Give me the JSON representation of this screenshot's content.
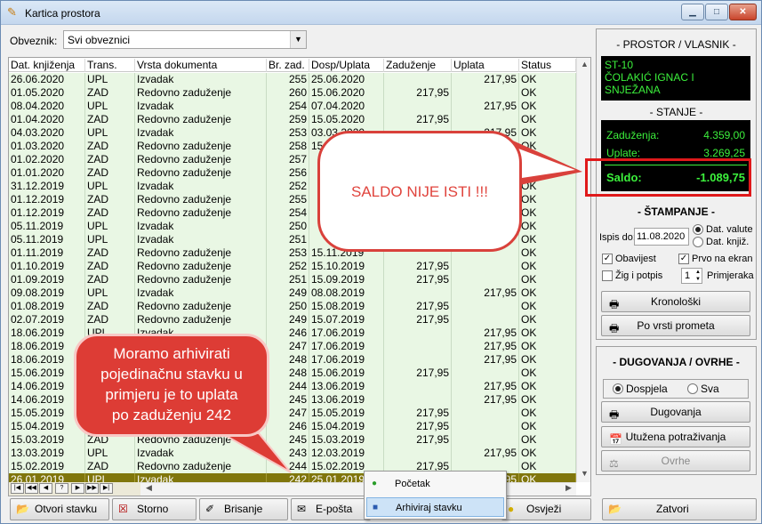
{
  "window": {
    "title": "Kartica prostora",
    "min": "▁",
    "max": "□",
    "close": "✕"
  },
  "filter": {
    "label": "Obveznik:",
    "value": "Svi obveznici"
  },
  "grid": {
    "headers": [
      "Dat. knjiženja",
      "Trans.",
      "Vrsta dokumenta",
      "Br. zad.",
      "Dosp/Uplata",
      "Zaduženje",
      "Uplata",
      "Status"
    ],
    "rows": [
      [
        "26.06.2020",
        "UPL",
        "Izvadak",
        "255",
        "25.06.2020",
        "",
        "217,95",
        "OK"
      ],
      [
        "01.05.2020",
        "ZAD",
        "Redovno zaduženje",
        "260",
        "15.06.2020",
        "217,95",
        "",
        "OK"
      ],
      [
        "08.04.2020",
        "UPL",
        "Izvadak",
        "254",
        "07.04.2020",
        "",
        "217,95",
        "OK"
      ],
      [
        "01.04.2020",
        "ZAD",
        "Redovno zaduženje",
        "259",
        "15.05.2020",
        "217,95",
        "",
        "OK"
      ],
      [
        "04.03.2020",
        "UPL",
        "Izvadak",
        "253",
        "03.03.2020",
        "",
        "217,95",
        "OK"
      ],
      [
        "01.03.2020",
        "ZAD",
        "Redovno zaduženje",
        "258",
        "15.04.2020",
        "",
        "",
        "OK"
      ],
      [
        "01.02.2020",
        "ZAD",
        "Redovno zaduženje",
        "257",
        "",
        "",
        "",
        "OK"
      ],
      [
        "01.01.2020",
        "ZAD",
        "Redovno zaduženje",
        "256",
        "",
        "",
        "",
        "OK"
      ],
      [
        "31.12.2019",
        "UPL",
        "Izvadak",
        "252",
        "",
        "",
        "",
        "OK"
      ],
      [
        "01.12.2019",
        "ZAD",
        "Redovno zaduženje",
        "255",
        "",
        "",
        "",
        "OK"
      ],
      [
        "01.12.2019",
        "ZAD",
        "Redovno zaduženje",
        "254",
        "",
        "",
        "",
        "OK"
      ],
      [
        "05.11.2019",
        "UPL",
        "Izvadak",
        "250",
        "",
        "",
        "",
        "OK"
      ],
      [
        "05.11.2019",
        "UPL",
        "Izvadak",
        "251",
        "",
        "",
        "",
        "OK"
      ],
      [
        "01.11.2019",
        "ZAD",
        "Redovno zaduženje",
        "253",
        "15.11.2019",
        "",
        "",
        "OK"
      ],
      [
        "01.10.2019",
        "ZAD",
        "Redovno zaduženje",
        "252",
        "15.10.2019",
        "217,95",
        "",
        "OK"
      ],
      [
        "01.09.2019",
        "ZAD",
        "Redovno zaduženje",
        "251",
        "15.09.2019",
        "217,95",
        "",
        "OK"
      ],
      [
        "09.08.2019",
        "UPL",
        "Izvadak",
        "249",
        "08.08.2019",
        "",
        "217,95",
        "OK"
      ],
      [
        "01.08.2019",
        "ZAD",
        "Redovno zaduženje",
        "250",
        "15.08.2019",
        "217,95",
        "",
        "OK"
      ],
      [
        "02.07.2019",
        "ZAD",
        "Redovno zaduženje",
        "249",
        "15.07.2019",
        "217,95",
        "",
        "OK"
      ],
      [
        "18.06.2019",
        "UPL",
        "Izvadak",
        "246",
        "17.06.2019",
        "",
        "217,95",
        "OK"
      ],
      [
        "18.06.2019",
        "UPL",
        "Izvadak",
        "247",
        "17.06.2019",
        "",
        "217,95",
        "OK"
      ],
      [
        "18.06.2019",
        "UPL",
        "Izvadak",
        "248",
        "17.06.2019",
        "",
        "217,95",
        "OK"
      ],
      [
        "15.06.2019",
        "ZAD",
        "Redovno zaduženje",
        "248",
        "15.06.2019",
        "217,95",
        "",
        "OK"
      ],
      [
        "14.06.2019",
        "UPL",
        "Izvadak",
        "244",
        "13.06.2019",
        "",
        "217,95",
        "OK"
      ],
      [
        "14.06.2019",
        "UPL",
        "Izvadak",
        "245",
        "13.06.2019",
        "",
        "217,95",
        "OK"
      ],
      [
        "15.05.2019",
        "ZAD",
        "Redovno zaduženje",
        "247",
        "15.05.2019",
        "217,95",
        "",
        "OK"
      ],
      [
        "15.04.2019",
        "ZAD",
        "Redovno zaduženje",
        "246",
        "15.04.2019",
        "217,95",
        "",
        "OK"
      ],
      [
        "15.03.2019",
        "ZAD",
        "Redovno zaduženje",
        "245",
        "15.03.2019",
        "217,95",
        "",
        "OK"
      ],
      [
        "13.03.2019",
        "UPL",
        "Izvadak",
        "243",
        "12.03.2019",
        "",
        "217,95",
        "OK"
      ],
      [
        "15.02.2019",
        "ZAD",
        "Redovno zaduženje",
        "244",
        "15.02.2019",
        "217,95",
        "",
        "OK"
      ],
      [
        "26.01.2019",
        "UPL",
        "Izvadak",
        "242",
        "25.01.2019",
        "",
        "217,95",
        "OK"
      ]
    ],
    "selected_row": 30,
    "nav": [
      "|◀",
      "◀◀",
      "◀",
      "?",
      "▶",
      "▶▶",
      "▶|"
    ]
  },
  "right": {
    "prostor_head": "- PROSTOR / VLASNIK -",
    "prostor_lines": [
      "ST-10",
      "ČOLAKIĆ IGNAC I",
      "SNJEŽANA"
    ],
    "stanje_head": "- STANJE -",
    "zaduzenja_label": "Zaduženja:",
    "zaduzenja_value": "4.359,00",
    "uplate_label": "Uplate:",
    "uplate_value": "3.269,25",
    "saldo_label": "Saldo:",
    "saldo_value": "-1.089,75",
    "stampanje_head": "- ŠTAMPANJE -",
    "ispis_label": "Ispis do:",
    "ispis_value": "11.08.2020",
    "opt_valute": "Dat. valute",
    "opt_knjiz": "Dat. knjiž.",
    "obavijest": "Obavijest",
    "prvo_na_ekran": "Prvo na ekran",
    "zig": "Žig i potpis",
    "primjeraka_value": "1",
    "primjeraka": "Primjeraka",
    "kronoloski": "Kronološki",
    "po_vrsti": "Po vrsti prometa",
    "dug_head": "- DUGOVANJA / OVRHE -",
    "dospjela": "Dospjela",
    "sva": "Sva",
    "dugovanja": "Dugovanja",
    "utuzena": "Utužena potraživanja",
    "ovrhe": "Ovrhe"
  },
  "bottom": {
    "otvori": "Otvori stavku",
    "storno": "Storno",
    "brisanje": "Brisanje",
    "eposta": "E-pošta",
    "osvjezi": "Osvježi",
    "zatvori": "Zatvori"
  },
  "context_menu": {
    "items": [
      "Početak",
      "Arhiviraj stavku"
    ]
  },
  "annotations": {
    "saldo_note": "SALDO NIJE ISTI !!!",
    "arhiv_note": [
      "Moramo arhivirati",
      "pojedinačnu stavku u",
      "primjeru je to uplata",
      "po zaduženju 242"
    ]
  },
  "colors": {
    "row_bg": "#e9f7e4",
    "selected_row": "#80760c",
    "callout_red": "#dd3c35",
    "panel_green": "#3cf03c"
  }
}
